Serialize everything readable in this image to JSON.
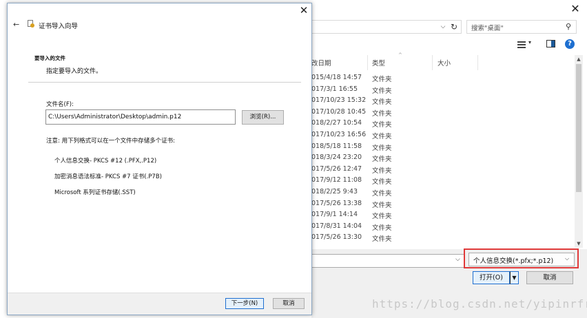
{
  "open_dialog": {
    "close_glyph": "✕",
    "search_placeholder": "搜索\"桌面\"",
    "columns": {
      "date": "改日期",
      "type": "类型",
      "size": "大小"
    },
    "files": [
      {
        "date": "015/4/18 14:57",
        "type": "文件夹"
      },
      {
        "date": "017/3/1 16:55",
        "type": "文件夹"
      },
      {
        "date": "017/10/23 15:32",
        "type": "文件夹"
      },
      {
        "date": "017/10/28 10:45",
        "type": "文件夹"
      },
      {
        "date": "018/2/27 10:54",
        "type": "文件夹"
      },
      {
        "date": "017/10/23 16:56",
        "type": "文件夹"
      },
      {
        "date": "018/5/18 11:58",
        "type": "文件夹"
      },
      {
        "date": "018/3/24 23:20",
        "type": "文件夹"
      },
      {
        "date": "017/5/26 12:47",
        "type": "文件夹"
      },
      {
        "date": "017/9/12 11:08",
        "type": "文件夹"
      },
      {
        "date": "018/2/25 9:43",
        "type": "文件夹"
      },
      {
        "date": "017/5/26 13:38",
        "type": "文件夹"
      },
      {
        "date": "017/9/1 14:14",
        "type": "文件夹"
      },
      {
        "date": "017/8/31 14:04",
        "type": "文件夹"
      },
      {
        "date": "017/5/26 13:30",
        "type": "文件夹"
      }
    ],
    "file_type_filter": "个人信息交换(*.pfx;*.p12)",
    "open_label": "打开(O)",
    "cancel_label": "取消",
    "highlight_color": "#e03a3a"
  },
  "wizard": {
    "close_glyph": "✕",
    "back_glyph": "←",
    "title": "证书导入向导",
    "heading": "要导入的文件",
    "subheading": "指定要导入的文件。",
    "file_label": "文件名(F):",
    "file_value": "C:\\Users\\Administrator\\Desktop\\admin.p12",
    "browse_label": "浏览(R)...",
    "note": "注意: 用下列格式可以在一个文件中存储多个证书:",
    "formats": [
      "个人信息交换- PKCS #12 (.PFX,.P12)",
      "加密消息语法标准- PKCS #7 证书(.P7B)",
      "Microsoft 系列证书存储(.SST)"
    ],
    "next_label": "下一步(N)",
    "cancel_label": "取消"
  },
  "watermark": "https://blog.csdn.net/yipinrfr"
}
